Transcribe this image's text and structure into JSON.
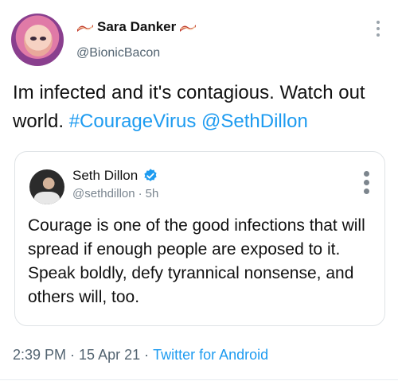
{
  "author": {
    "display_name": "Sara Danker",
    "handle": "@BionicBacon"
  },
  "tweet": {
    "text_plain": "Im infected and it's contagious. Watch out world.",
    "hashtag": "#CourageVirus",
    "mention": "@SethDillon"
  },
  "quoted": {
    "display_name": "Seth Dillon",
    "handle": "@sethdillon",
    "separator": "·",
    "age": "5h",
    "text": "Courage is one of the good infections that will spread if enough people are exposed to it. Speak boldly, defy tyrannical nonsense, and others will, too."
  },
  "footer": {
    "time": "2:39 PM",
    "sep1": "·",
    "date": "15 Apr 21",
    "sep2": "·",
    "source": "Twitter for Android"
  },
  "colors": {
    "link": "#1d9bf0",
    "muted": "#536471",
    "verified": "#1d9bf0"
  },
  "icons": {
    "author_decoration": "bacon-icon",
    "menu": "more-vertical-icon",
    "verified": "verified-badge-icon"
  }
}
